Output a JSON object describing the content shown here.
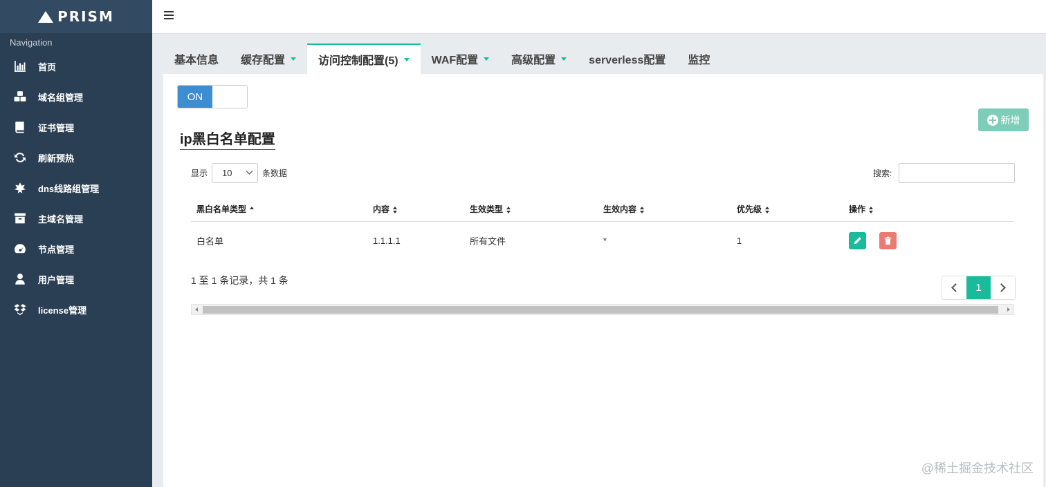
{
  "brand": {
    "name": "PRISM"
  },
  "sidebar": {
    "heading": "Navigation",
    "items": [
      {
        "label": "首页",
        "icon": "bar-chart-icon"
      },
      {
        "label": "域名组管理",
        "icon": "cubes-icon"
      },
      {
        "label": "证书管理",
        "icon": "book-icon"
      },
      {
        "label": "刷新预热",
        "icon": "refresh-icon"
      },
      {
        "label": "dns线路组管理",
        "icon": "leaf-icon"
      },
      {
        "label": "主域名管理",
        "icon": "archive-icon"
      },
      {
        "label": "节点管理",
        "icon": "dashboard-icon"
      },
      {
        "label": "用户管理",
        "icon": "user-icon"
      },
      {
        "label": "license管理",
        "icon": "dropbox-icon"
      }
    ]
  },
  "tabs": [
    {
      "label": "基本信息",
      "dropdown": false
    },
    {
      "label": "缓存配置",
      "dropdown": true
    },
    {
      "label": "访问控制配置(5)",
      "dropdown": true,
      "active": true
    },
    {
      "label": "WAF配置",
      "dropdown": true
    },
    {
      "label": "高级配置",
      "dropdown": true
    },
    {
      "label": "serverless配置",
      "dropdown": false
    },
    {
      "label": "监控",
      "dropdown": false
    }
  ],
  "toggle": {
    "label": "ON"
  },
  "toolbar": {
    "add_label": "新增"
  },
  "section": {
    "title": "ip黑白名单配置"
  },
  "length_control": {
    "prefix": "显示",
    "value": "10",
    "suffix": "条数据"
  },
  "search": {
    "label": "搜索:",
    "value": ""
  },
  "table": {
    "headers": [
      "黑白名单类型",
      "内容",
      "生效类型",
      "生效内容",
      "优先级",
      "操作"
    ],
    "rows": [
      [
        "白名单",
        "1.1.1.1",
        "所有文件",
        "*",
        "1"
      ]
    ]
  },
  "table_info": "1 至 1 条记录，共 1 条",
  "pagination": {
    "current": "1"
  },
  "watermark": "@稀土掘金技术社区",
  "colors": {
    "sidebar": "#2a3f54",
    "accent": "#1abb9c",
    "toggle_on": "#3c8dd1",
    "delete": "#e97b72"
  }
}
